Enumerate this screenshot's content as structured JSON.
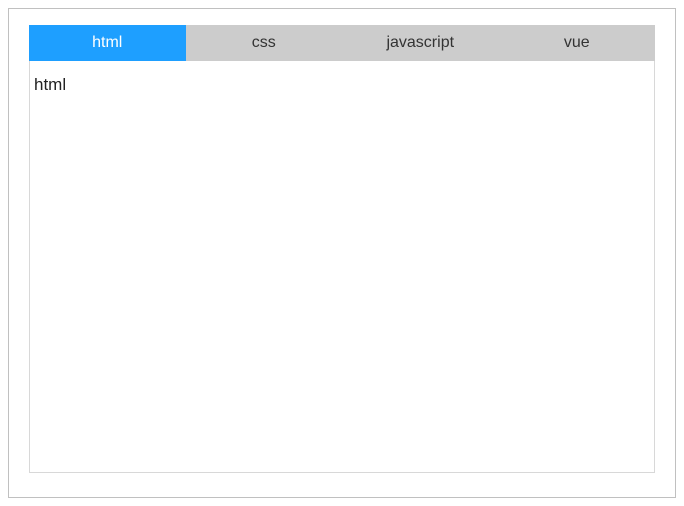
{
  "tabs": [
    {
      "label": "html",
      "active": true
    },
    {
      "label": "css",
      "active": false
    },
    {
      "label": "javascript",
      "active": false
    },
    {
      "label": "vue",
      "active": false
    }
  ],
  "content": {
    "active_text": "html"
  }
}
